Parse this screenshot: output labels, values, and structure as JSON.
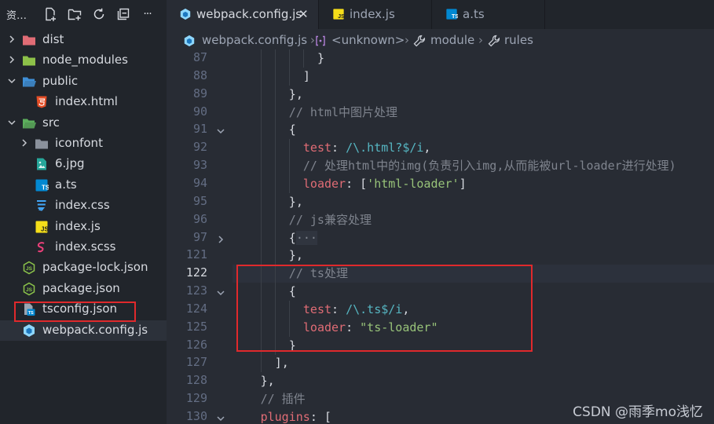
{
  "explorer": {
    "title": "资…",
    "actions": [
      {
        "icon": "new-file-icon"
      },
      {
        "icon": "new-folder-icon"
      },
      {
        "icon": "refresh-icon"
      },
      {
        "icon": "collapse-all-icon"
      },
      {
        "icon": "more-icon",
        "glyph": "···"
      }
    ],
    "items": [
      {
        "label": "dist",
        "kind": "folder",
        "expanded": false,
        "color": "#e06c75",
        "depth": 0
      },
      {
        "label": "node_modules",
        "kind": "folder",
        "expanded": false,
        "color": "#8dc149",
        "depth": 0
      },
      {
        "label": "public",
        "kind": "folder",
        "expanded": true,
        "color": "#3f8fd6",
        "depth": 0
      },
      {
        "label": "index.html",
        "kind": "html",
        "depth": 1
      },
      {
        "label": "src",
        "kind": "folder",
        "expanded": true,
        "color": "#5cae5c",
        "depth": 0
      },
      {
        "label": "iconfont",
        "kind": "folder",
        "expanded": false,
        "color": "#8a919c",
        "depth": 1
      },
      {
        "label": "6.jpg",
        "kind": "image",
        "depth": 1
      },
      {
        "label": "a.ts",
        "kind": "ts",
        "depth": 1
      },
      {
        "label": "index.css",
        "kind": "css",
        "depth": 1
      },
      {
        "label": "index.js",
        "kind": "js",
        "depth": 1
      },
      {
        "label": "index.scss",
        "kind": "scss",
        "depth": 1
      },
      {
        "label": "package-lock.json",
        "kind": "node-json",
        "depth": 0
      },
      {
        "label": "package.json",
        "kind": "node-json",
        "depth": 0
      },
      {
        "label": "tsconfig.json",
        "kind": "tsconfig",
        "depth": 0
      },
      {
        "label": "webpack.config.js",
        "kind": "webpack",
        "depth": 0,
        "selected": true
      }
    ]
  },
  "tabs": [
    {
      "label": "webpack.config.js",
      "icon": "webpack-icon",
      "active": true,
      "close": "✕"
    },
    {
      "label": "index.js",
      "icon": "js-icon",
      "active": false
    },
    {
      "label": "a.ts",
      "icon": "ts-icon",
      "active": false
    }
  ],
  "breadcrumbs": [
    {
      "label": "webpack.config.js",
      "icon": "webpack-icon"
    },
    {
      "label": "<unknown>",
      "icon": "unknown-symbol-icon"
    },
    {
      "label": "module",
      "icon": "wrench-icon"
    },
    {
      "label": "rules",
      "icon": "wrench-icon"
    }
  ],
  "breadcrumb_separator": "›",
  "editor": {
    "active_line": "122",
    "lines": [
      {
        "n": "87",
        "indent": 5,
        "fold": "",
        "tokens": [
          {
            "t": "}",
            "c": "p"
          }
        ]
      },
      {
        "n": "88",
        "indent": 4,
        "fold": "",
        "tokens": [
          {
            "t": "]",
            "c": "p"
          }
        ]
      },
      {
        "n": "89",
        "indent": 3,
        "fold": "",
        "tokens": [
          {
            "t": "},",
            "c": "p"
          }
        ]
      },
      {
        "n": "90",
        "indent": 3,
        "fold": "",
        "tokens": [
          {
            "t": "// html中图片处理",
            "c": "cm"
          }
        ]
      },
      {
        "n": "91",
        "indent": 3,
        "fold": "open",
        "tokens": [
          {
            "t": "{",
            "c": "p"
          }
        ]
      },
      {
        "n": "92",
        "indent": 4,
        "fold": "",
        "tokens": [
          {
            "t": "test",
            "c": "k"
          },
          {
            "t": ": ",
            "c": "p"
          },
          {
            "t": "/\\.html?$/i",
            "c": "r"
          },
          {
            "t": ",",
            "c": "p"
          }
        ]
      },
      {
        "n": "93",
        "indent": 4,
        "fold": "",
        "tokens": [
          {
            "t": "// 处理html中的img(负责引入img,从而能被url-loader进行处理)",
            "c": "cm"
          }
        ]
      },
      {
        "n": "94",
        "indent": 4,
        "fold": "",
        "tokens": [
          {
            "t": "loader",
            "c": "k"
          },
          {
            "t": ": [",
            "c": "p"
          },
          {
            "t": "'html-loader'",
            "c": "s"
          },
          {
            "t": "]",
            "c": "p"
          }
        ]
      },
      {
        "n": "95",
        "indent": 3,
        "fold": "",
        "tokens": [
          {
            "t": "},",
            "c": "p"
          }
        ]
      },
      {
        "n": "96",
        "indent": 3,
        "fold": "",
        "tokens": [
          {
            "t": "// js兼容处理",
            "c": "cm"
          }
        ]
      },
      {
        "n": "97",
        "indent": 3,
        "fold": "closed",
        "tokens": [
          {
            "t": "{",
            "c": "p"
          },
          {
            "t": "···",
            "c": "fo"
          }
        ]
      },
      {
        "n": "121",
        "indent": 3,
        "fold": "",
        "tokens": [
          {
            "t": "},",
            "c": "p"
          }
        ]
      },
      {
        "n": "122",
        "indent": 3,
        "fold": "",
        "tokens": [
          {
            "t": "// ts处理",
            "c": "cm"
          }
        ]
      },
      {
        "n": "123",
        "indent": 3,
        "fold": "open",
        "tokens": [
          {
            "t": "{",
            "c": "p"
          }
        ]
      },
      {
        "n": "124",
        "indent": 4,
        "fold": "",
        "tokens": [
          {
            "t": "test",
            "c": "k"
          },
          {
            "t": ": ",
            "c": "p"
          },
          {
            "t": "/\\.ts$/i",
            "c": "r"
          },
          {
            "t": ",",
            "c": "p"
          }
        ]
      },
      {
        "n": "125",
        "indent": 4,
        "fold": "",
        "tokens": [
          {
            "t": "loader",
            "c": "k"
          },
          {
            "t": ": ",
            "c": "p"
          },
          {
            "t": "\"ts-loader\"",
            "c": "s"
          }
        ]
      },
      {
        "n": "126",
        "indent": 3,
        "fold": "",
        "tokens": [
          {
            "t": "}",
            "c": "p"
          }
        ]
      },
      {
        "n": "127",
        "indent": 2,
        "fold": "",
        "tokens": [
          {
            "t": "],",
            "c": "p"
          }
        ]
      },
      {
        "n": "128",
        "indent": 1,
        "fold": "",
        "tokens": [
          {
            "t": "},",
            "c": "p"
          }
        ]
      },
      {
        "n": "129",
        "indent": 1,
        "fold": "",
        "tokens": [
          {
            "t": "// 插件",
            "c": "cm"
          }
        ]
      },
      {
        "n": "130",
        "indent": 1,
        "fold": "open",
        "tokens": [
          {
            "t": "plugins",
            "c": "k"
          },
          {
            "t": ": [",
            "c": "p"
          }
        ]
      }
    ]
  },
  "watermark": "CSDN @雨季mo浅忆",
  "colors": {
    "highlight": "#e0292c",
    "accent": "#528bff"
  }
}
